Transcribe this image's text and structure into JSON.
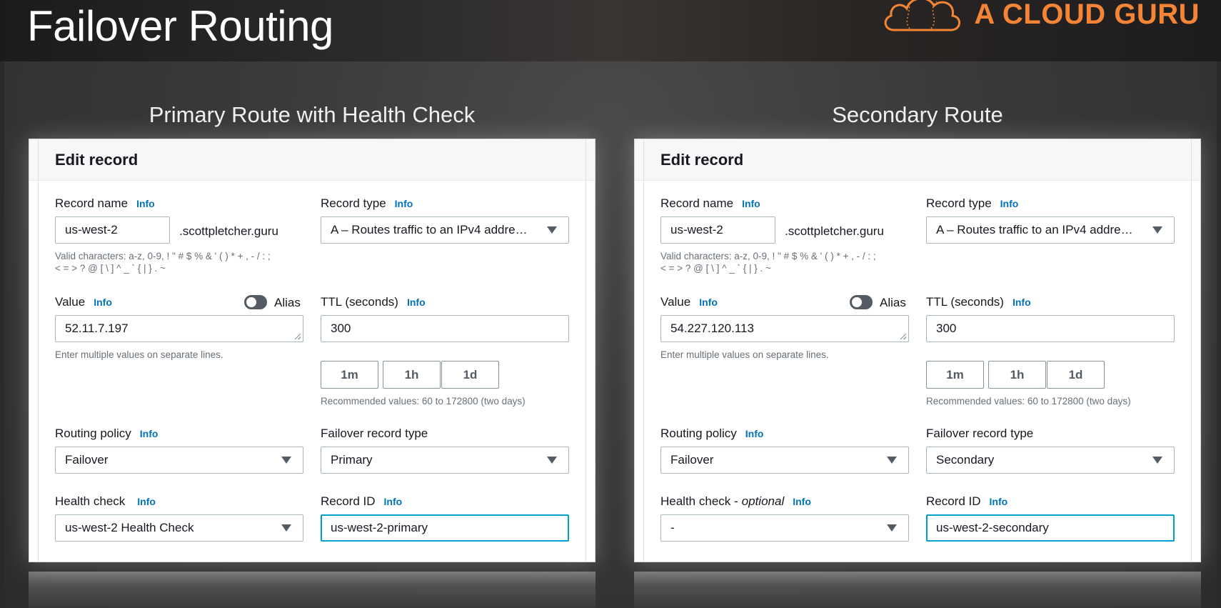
{
  "slide": {
    "title": "Failover Routing",
    "logo_text": "A CLOUD GURU"
  },
  "panels": [
    {
      "heading": "Primary Route with Health Check",
      "form_title": "Edit record",
      "record_name_label": "Record name",
      "record_name_value": "us-west-2",
      "domain_suffix": ".scottpletcher.guru",
      "valid_chars_line1": "Valid characters: a-z, 0-9, ! \" # $ % & ' ( ) * + , - / : ;",
      "valid_chars_line2": "< = > ? @ [ \\ ] ^ _ ` { | } . ~",
      "record_type_label": "Record type",
      "record_type_value": "A – Routes traffic to an IPv4 addre…",
      "value_label": "Value",
      "value_value": "52.11.7.197",
      "value_hint": "Enter multiple values on separate lines.",
      "alias_label": "Alias",
      "ttl_label": "TTL (seconds)",
      "ttl_value": "300",
      "ttl_buttons": [
        "1m",
        "1h",
        "1d"
      ],
      "ttl_hint": "Recommended values: 60 to 172800 (two days)",
      "routing_policy_label": "Routing policy",
      "routing_policy_value": "Failover",
      "failover_type_label": "Failover record type",
      "failover_type_value": "Primary",
      "health_check_label": "Health check",
      "health_check_optional": "",
      "health_check_value": "us-west-2 Health Check",
      "record_id_label": "Record ID",
      "record_id_value": "us-west-2-primary",
      "info": "Info"
    },
    {
      "heading": "Secondary Route",
      "form_title": "Edit record",
      "record_name_label": "Record name",
      "record_name_value": "us-west-2",
      "domain_suffix": ".scottpletcher.guru",
      "valid_chars_line1": "Valid characters: a-z, 0-9, ! \" # $ % & ' ( ) * + , - / : ;",
      "valid_chars_line2": "< = > ? @ [ \\ ] ^ _ ` { | } . ~",
      "record_type_label": "Record type",
      "record_type_value": "A – Routes traffic to an IPv4 addre…",
      "value_label": "Value",
      "value_value": "54.227.120.113",
      "value_hint": "Enter multiple values on separate lines.",
      "alias_label": "Alias",
      "ttl_label": "TTL (seconds)",
      "ttl_value": "300",
      "ttl_buttons": [
        "1m",
        "1h",
        "1d"
      ],
      "ttl_hint": "Recommended values: 60 to 172800 (two days)",
      "routing_policy_label": "Routing policy",
      "routing_policy_value": "Failover",
      "failover_type_label": "Failover record type",
      "failover_type_value": "Secondary",
      "health_check_label": "Health check -",
      "health_check_optional": "optional",
      "health_check_value": "-",
      "record_id_label": "Record ID",
      "record_id_value": "us-west-2-secondary",
      "info": "Info"
    }
  ],
  "colors": {
    "accent_focus": "#00a1c9",
    "info_link": "#0073bb",
    "logo": "#f58536"
  }
}
